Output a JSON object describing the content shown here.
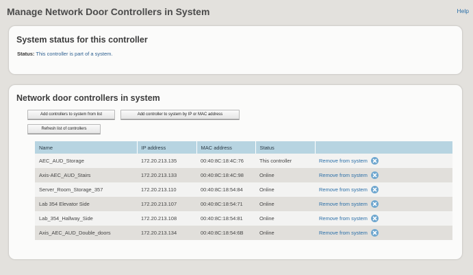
{
  "page": {
    "title": "Manage Network Door Controllers in System",
    "help_label": "Help"
  },
  "system_status": {
    "heading": "System status for this controller",
    "status_label": "Status:",
    "status_value": "This controller is part of a system."
  },
  "controllers": {
    "heading": "Network door controllers in system",
    "buttons": {
      "add_from_list": "Add controllers to system from list",
      "add_by_ip_mac": "Add controller to system by IP or MAC address",
      "refresh": "Refresh list of controllers"
    },
    "columns": [
      "Name",
      "IP address",
      "MAC address",
      "Status",
      ""
    ],
    "remove_label": "Remove from system",
    "rows": [
      {
        "name": "AEC_AUD_Storage",
        "ip": "172.20.213.135",
        "mac": "00:40:8C:18:4C:76",
        "status": "This controller"
      },
      {
        "name": "Axis-AEC_AUD_Stairs",
        "ip": "172.20.213.133",
        "mac": "00:40:8C:18:4C:98",
        "status": "Online"
      },
      {
        "name": "Server_Room_Storage_357",
        "ip": "172.20.213.110",
        "mac": "00:40:8C:18:54:84",
        "status": "Online"
      },
      {
        "name": "Lab 354 Elevator Side",
        "ip": "172.20.213.107",
        "mac": "00:40:8C:18:54:71",
        "status": "Online"
      },
      {
        "name": "Lab_354_Hallway_Side",
        "ip": "172.20.213.108",
        "mac": "00:40:8C:18:54:81",
        "status": "Online"
      },
      {
        "name": "Axis_AEC_AUD_Double_doors",
        "ip": "172.20.213.134",
        "mac": "00:40:8C:18:54:6B",
        "status": "Online"
      }
    ]
  },
  "icons": {
    "remove": "remove-circle-icon"
  },
  "colors": {
    "accent": "#2b6fa8",
    "table_header": "#b7d4e1",
    "remove_icon": "#6fa7cf"
  }
}
